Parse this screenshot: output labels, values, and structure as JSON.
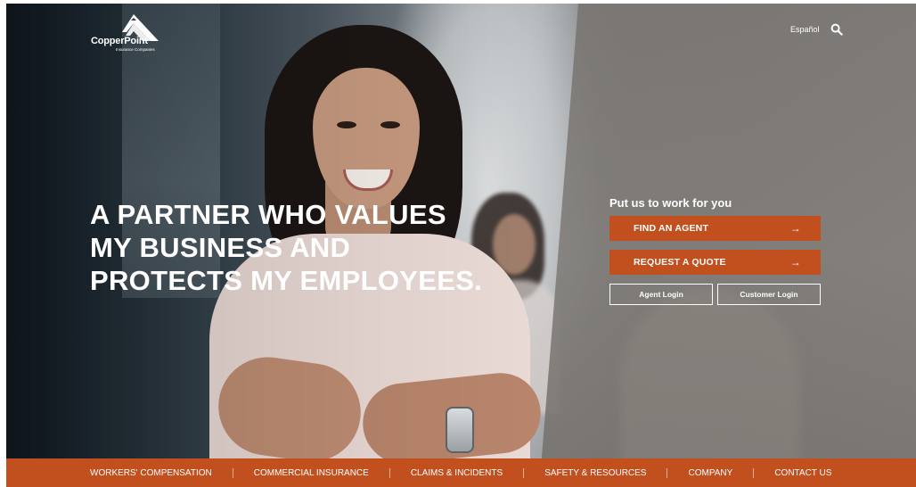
{
  "brand": {
    "name": "CopperPoint",
    "tagline": "Insurance Companies"
  },
  "utility": {
    "language_label": "Español",
    "search_icon": "search-icon"
  },
  "hero": {
    "headline_lines": [
      "A PARTNER WHO VALUES",
      "MY BUSINESS AND",
      "PROTECTS MY EMPLOYEES."
    ]
  },
  "cta": {
    "title": "Put us to work for you",
    "find_agent_label": "FIND AN AGENT",
    "request_quote_label": "REQUEST A QUOTE",
    "arrow_glyph": "→",
    "agent_login_label": "Agent Login",
    "customer_login_label": "Customer Login"
  },
  "nav": {
    "items": [
      {
        "label": "WORKERS' COMPENSATION"
      },
      {
        "label": "COMMERCIAL INSURANCE"
      },
      {
        "label": "CLAIMS & INCIDENTS"
      },
      {
        "label": "SAFETY & RESOURCES"
      },
      {
        "label": "COMPANY"
      },
      {
        "label": "CONTACT US"
      }
    ]
  },
  "colors": {
    "accent": "#c2501f",
    "text_on_dark": "#ffffff"
  }
}
